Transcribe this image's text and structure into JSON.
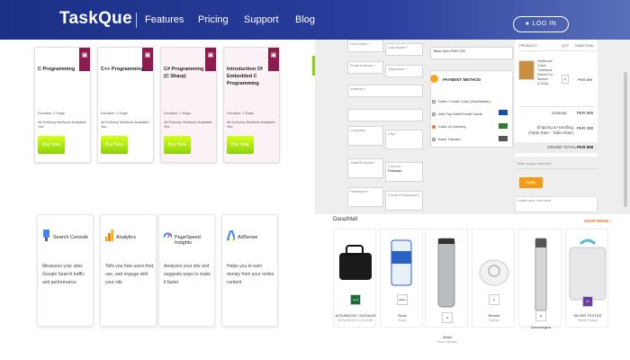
{
  "nav": {
    "logo": "TaskQue",
    "links": [
      "Features",
      "Pricing",
      "Support",
      "Blog"
    ],
    "login": "LOG IN",
    "colors": {
      "bar": "#1b2f86",
      "accent": "#f57224"
    }
  },
  "courses": [
    {
      "title": "C Programming",
      "duration": "Duration: 2 Days",
      "delivery": "All Delivery Methods Available: Yes",
      "button": "Buy Now"
    },
    {
      "title": "C++ Programming",
      "duration": "Duration: 2 Days",
      "delivery": "All Delivery Methods Available: Yes",
      "button": "Buy Now"
    },
    {
      "title": "C# Programming (C Sharp)",
      "duration": "Duration: 2 Days",
      "delivery": "All Delivery Methods Available: Yes",
      "button": "Buy Now"
    },
    {
      "title": "Introduction Of Embedded C Programming",
      "duration": "Duration: 2 Days",
      "delivery": "All Delivery Methods Available: Yes",
      "button": "Buy Now"
    }
  ],
  "tools": [
    {
      "name": "Search Console",
      "desc": "Measures your sites Google Search traffic and performance",
      "icon": "search-console-icon"
    },
    {
      "name": "Analytics",
      "desc": "Tells you how users find, use, and engage with your site",
      "icon": "analytics-icon"
    },
    {
      "name": "PageSpeed Insights",
      "desc": "Analyzes your site and suggests ways to make it faster",
      "icon": "pagespeed-icon"
    },
    {
      "name": "AdSense",
      "desc": "Helps you to earn money from your online content",
      "icon": "adsense-icon"
    }
  ],
  "checkout": {
    "first_name": "First Name *",
    "last_name": "Last Name *",
    "email": "Email Address *",
    "telephone": "Telephone *",
    "address": "Address *",
    "company": "Company",
    "city": "City *",
    "state": "State/Province *",
    "country_label": "Country *",
    "country_value": "Pakistan",
    "password": "Password *",
    "confirm_password": "Confirm Password *",
    "total_text": "Table from PKR 200",
    "payment_heading": "PAYMENT METHOD",
    "payment_options": [
      "Debit / Credit Card (Visa/Master)",
      "Alfa Pay Debit/Credit Cards",
      "Cash on Delivery",
      "Bank Transfer"
    ],
    "summary_headers": [
      "PRODUCT",
      "QTY",
      "SUBTOTAL"
    ],
    "product_name": "Healthcare Online Traditional Sarees For Women (CGSA)",
    "product_qty": "1",
    "product_subtotal": "PKR 699",
    "subtotal_label": "Subtotal",
    "subtotal_value": "PKR 699",
    "shipping_label": "Shipping & Handling (Table Rate - Table Rate)",
    "shipping_value": "PKR 200",
    "grand_label": "GRAND TOTAL",
    "grand_value": "PKR 899",
    "coupon_placeholder": "Enter coupon code here",
    "apply": "Apply",
    "comment_placeholder": "Leave your comment"
  },
  "mall": {
    "title": "DarazMall",
    "shop_more": "SHOP MORE",
    "items": [
      {
        "name": "Al RUBAIYAT LUGGAGE",
        "sub": "Al RUBAIYAT LUGGAGE",
        "logo": "ALR"
      },
      {
        "name": "Roze",
        "sub": "Roze",
        "logo": "Roze"
      },
      {
        "name": "Zilare",
        "sub": "Photo Service",
        "logo": "Z"
      },
      {
        "name": "Reeme",
        "sub": "Reeme",
        "logo": "R"
      },
      {
        "name": "Dermalogica",
        "sub": "Dermalogica",
        "logo": "D"
      },
      {
        "name": "SILVER TEXTILE",
        "sub": "Textile Factory",
        "logo": "ST"
      }
    ]
  }
}
